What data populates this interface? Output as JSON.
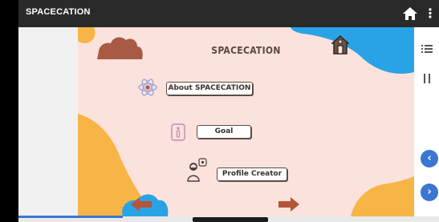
{
  "app": {
    "title": "SPACECATION"
  },
  "slide": {
    "title": "SPACECATION",
    "menu": [
      {
        "label": "About SPACECATION",
        "icon": "atom-icon"
      },
      {
        "label": "Goal",
        "icon": "info-icon"
      },
      {
        "label": "Profile Creator",
        "icon": "person-icon"
      }
    ]
  },
  "colors": {
    "topbar": "#2a2a2a",
    "slide_bg": "#fbe2dd",
    "blob_blue": "#2aa3e6",
    "blob_orange": "#f7b547",
    "cloud": "#a85a45",
    "arrow": "#b4553a",
    "nav_blue": "#3a76d2"
  },
  "icons": {
    "home": "home-icon",
    "more": "more-vert-icon",
    "slide_home": "house-icon",
    "list": "list-icon",
    "pause": "pause-icon",
    "back": "arrow-left-icon",
    "next": "arrow-right-icon",
    "prev_circle": "chevron-left-icon",
    "next_circle": "chevron-right-icon"
  }
}
